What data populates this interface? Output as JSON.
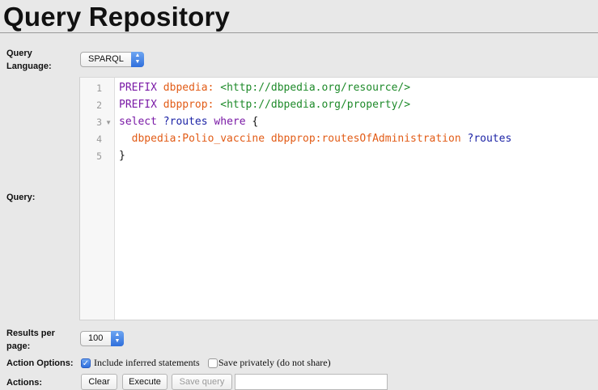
{
  "page": {
    "title": "Query Repository"
  },
  "form": {
    "query_language": {
      "label_line1": "Query",
      "label_line2": "Language:",
      "value": "SPARQL"
    },
    "query": {
      "label": "Query:",
      "line_numbers": [
        "1",
        "2",
        "3",
        "4",
        "5"
      ],
      "lines": [
        [
          {
            "t": "PREFIX ",
            "c": "kw"
          },
          {
            "t": "dbpedia:",
            "c": "pfx"
          },
          {
            "t": " ",
            "c": "plain"
          },
          {
            "t": "<http://dbpedia.org/resource/>",
            "c": "uri"
          }
        ],
        [
          {
            "t": "PREFIX ",
            "c": "kw"
          },
          {
            "t": "dbpprop:",
            "c": "pfx"
          },
          {
            "t": " ",
            "c": "plain"
          },
          {
            "t": "<http://dbpedia.org/property/>",
            "c": "uri"
          }
        ],
        [
          {
            "t": "select ",
            "c": "kw"
          },
          {
            "t": "?routes",
            "c": "var"
          },
          {
            "t": " ",
            "c": "plain"
          },
          {
            "t": "where",
            "c": "kw"
          },
          {
            "t": " {",
            "c": "plain"
          }
        ],
        [
          {
            "t": "  ",
            "c": "plain"
          },
          {
            "t": "dbpedia:Polio_vaccine",
            "c": "pfx"
          },
          {
            "t": " ",
            "c": "plain"
          },
          {
            "t": "dbpprop:routesOfAdministration",
            "c": "pfx"
          },
          {
            "t": " ",
            "c": "plain"
          },
          {
            "t": "?routes",
            "c": "var"
          }
        ],
        [
          {
            "t": "}",
            "c": "plain"
          }
        ]
      ]
    },
    "results_per_page": {
      "label_line1": "Results per",
      "label_line2": "page:",
      "value": "100"
    },
    "action_options": {
      "label": "Action Options:",
      "include_inferred": {
        "label": "Include inferred statements",
        "checked": true
      },
      "save_privately": {
        "label": "Save privately (do not share)",
        "checked": false
      }
    },
    "actions": {
      "label": "Actions:",
      "clear": "Clear",
      "execute": "Execute",
      "save_query": "Save query"
    }
  }
}
